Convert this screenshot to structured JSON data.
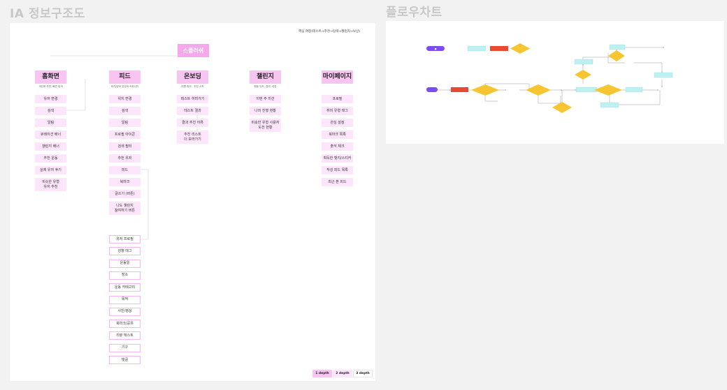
{
  "titles": {
    "ia": "IA 정보구조도",
    "flow": "플로우차트"
  },
  "ia": {
    "top_note": "핵심 여정(테스트→추천→탐색→챌린지→보상)",
    "root": "스플러쉬",
    "columns": [
      {
        "title": "홈화면",
        "subtitle": "개인화 추천, 빠른 탐색",
        "items": [
          "유저 변경",
          "검색",
          "알림",
          "큐레이션 배너",
          "챌린지 배너",
          "추천 운동",
          "실제 유저 후기",
          "비슷한 유형\n유저 추천"
        ]
      },
      {
        "title": "피드",
        "subtitle": "후기/정보 공유와 커뮤니티",
        "items": [
          "위치 변경",
          "검색",
          "알림",
          "프로필 아이콘",
          "검색 필터",
          "추천 유저",
          "피드",
          "북마크",
          "글쓰기 (버튼)",
          "나도 챌린지\n참여하기 버튼"
        ]
      },
      {
        "title": "온보딩",
        "subtitle": "취향 파악 · 추천 시작",
        "items": [
          "테스트 하러가기",
          "테스트 결과",
          "결과 추천 이유",
          "추천 리스트\n더 보러가기"
        ]
      },
      {
        "title": "챌린지",
        "subtitle": "행동 유도, 참여, 성장",
        "items": [
          "이번 주 미션",
          "나의 진행 현황",
          "비슷한 유형 사용자\n도전 현황"
        ]
      },
      {
        "title": "마이페이지",
        "subtitle": "",
        "items": [
          "프로필",
          "취미 유형 태그",
          "관심 설정",
          "북마크 목록",
          "출석 체크",
          "획득한 뱃지/스티커",
          "작성 피드 목록",
          "최근 본 피드"
        ]
      }
    ],
    "feed_sub": [
      "유저 프로필",
      "성향 태그",
      "운동일",
      "장소",
      "운동 카테고리",
      "목적",
      "사진/영상",
      "북마크/공유",
      "리뷰 텍스트",
      "기구",
      "댓글"
    ],
    "legend": [
      "1 depth",
      "2 depth",
      "3 depth"
    ]
  },
  "colors": {
    "root": "#f6a8ec",
    "depth1": "#f8c4f2",
    "depth2": "#fde6fb",
    "depth3_border": "#f5b8ee",
    "flow_start": "#7b4cf0",
    "flow_process": "#e84a2f",
    "flow_decision": "#f7c531",
    "flow_data": "#bff0f0"
  }
}
